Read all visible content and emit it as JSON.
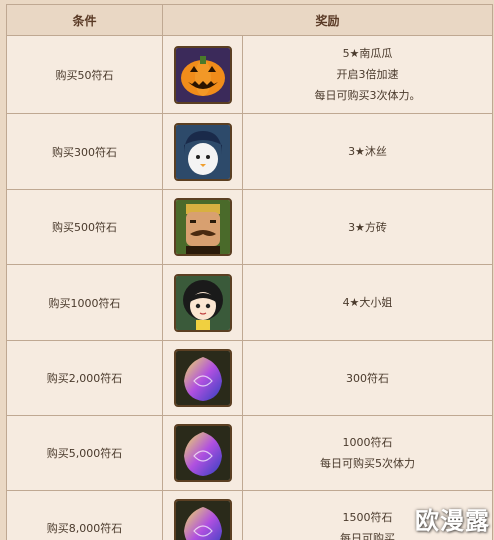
{
  "table": {
    "headers": [
      "条件",
      "奖励"
    ],
    "rows": [
      {
        "condition": "购买50符石",
        "icon": "pumpkin-icon",
        "reward": [
          "5★南瓜瓜",
          "开启3倍加速",
          "每日可购买3次体力。"
        ]
      },
      {
        "condition": "购买300符石",
        "icon": "ghost-character-icon",
        "reward": [
          "3★沐丝"
        ]
      },
      {
        "condition": "购买500符石",
        "icon": "mustache-man-icon",
        "reward": [
          "3★方砖"
        ]
      },
      {
        "condition": "购买1000符石",
        "icon": "girl-character-icon",
        "reward": [
          "4★大小姐"
        ]
      },
      {
        "condition": "购买2,000符石",
        "icon": "rune-stone-icon",
        "reward": [
          "300符石"
        ]
      },
      {
        "condition": "购买5,000符石",
        "icon": "rune-stone-icon",
        "reward": [
          "1000符石",
          "每日可购买5次体力"
        ]
      },
      {
        "condition": "购买8,000符石",
        "icon": "rune-stone-icon",
        "reward": [
          "1500符石",
          "每日可购买"
        ]
      }
    ]
  },
  "watermark": "欧漫露",
  "colors": {
    "background": "#ead8c4",
    "cell": "#f6ebe0",
    "border": "#bfa892",
    "text": "#4a3a2c"
  }
}
